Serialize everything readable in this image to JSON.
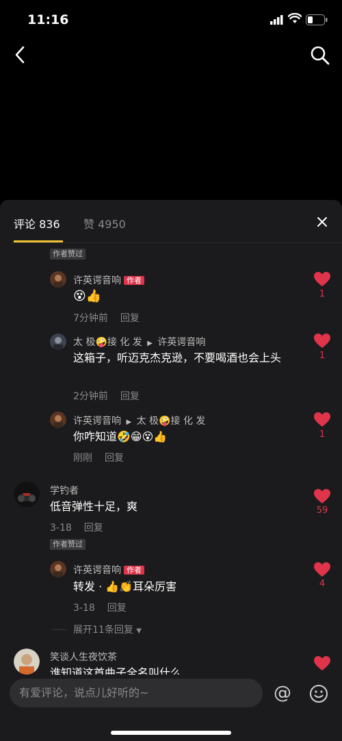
{
  "status_bar": {
    "time": "11:16"
  },
  "panel": {
    "tab_comments": "评论 836",
    "tab_likes": "赞 4950"
  },
  "badges": {
    "author_liked": "作者赞过",
    "author": "作者"
  },
  "comments": [
    {
      "name": "许英谔音响",
      "text": "😵👍",
      "time": "7分钟前",
      "reply": "回复",
      "likes": "1"
    },
    {
      "name": "太 极🤪接 化 发",
      "target": "许英谔音响",
      "text": "这箱子，听迈克杰克逊，不要喝酒也会上头",
      "time": "2分钟前",
      "reply": "回复",
      "likes": "1"
    },
    {
      "name": "许英谔音响",
      "target": "太 极🤪接 化 发",
      "text": "你咋知道🤣😁😵👍",
      "time": "刚刚",
      "reply": "回复",
      "likes": "1"
    },
    {
      "name": "学钓者",
      "text": "低音弹性十足，爽",
      "time": "3-18",
      "reply": "回复",
      "likes": "59"
    },
    {
      "name": "许英谔音响",
      "text": "转发 · 👍👏耳朵厉害",
      "time": "3-18",
      "reply": "回复",
      "likes": "4"
    },
    {
      "name": "笑谈人生夜饮茶",
      "text": "谁知道这首曲子全名叫什么"
    }
  ],
  "expand": "展开11条回复",
  "input": {
    "placeholder": "有爱评论，说点儿好听的~"
  },
  "colors": {
    "accent_heart": "#e0344b",
    "tab_underline": "#f1c232"
  }
}
